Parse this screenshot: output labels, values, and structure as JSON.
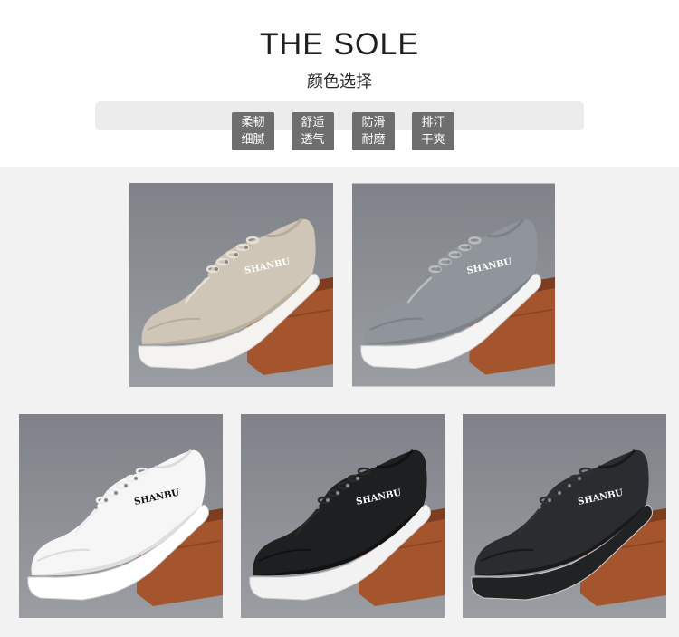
{
  "header": {
    "title": "THE SOLE",
    "subtitle": "颜色选择"
  },
  "features": [
    {
      "line1": "柔韧",
      "line2": "细腻"
    },
    {
      "line1": "舒适",
      "line2": "透气"
    },
    {
      "line1": "防滑",
      "line2": "耐磨"
    },
    {
      "line1": "排汗",
      "line2": "干爽"
    }
  ],
  "colors": {
    "tile_bg": "#8a8d93",
    "box": "#a4552d",
    "box_dark": "#7e3d1f"
  },
  "products": [
    {
      "name": "khaki-shoe",
      "brand": "SHANBU",
      "upper": "#cfc6b8",
      "upper_shade": "#b7ad9d",
      "sole": "#f4f3f0",
      "lace": "#e6e0d6",
      "text": "#ffffff"
    },
    {
      "name": "gray-shoe",
      "brand": "SHANBU",
      "upper": "#8f959b",
      "upper_shade": "#7b8187",
      "sole": "#f4f4f4",
      "lace": "#b9bcc0",
      "text": "#ffffff"
    },
    {
      "name": "white-shoe",
      "brand": "SHANBU",
      "upper": "#f6f6f6",
      "upper_shade": "#dcdcdc",
      "sole": "#ffffff",
      "lace": "#eeeeee",
      "text": "#111111"
    },
    {
      "name": "black-white-sole-shoe",
      "brand": "SHANBU",
      "upper": "#1e1f21",
      "upper_shade": "#101112",
      "sole": "#f2f2f2",
      "lace": "#2a2a2a",
      "text": "#ffffff"
    },
    {
      "name": "all-black-shoe",
      "brand": "SHANBU",
      "upper": "#2a2c2f",
      "upper_shade": "#17181a",
      "sole": "#202224",
      "lace": "#2f3134",
      "text": "#ffffff"
    }
  ]
}
